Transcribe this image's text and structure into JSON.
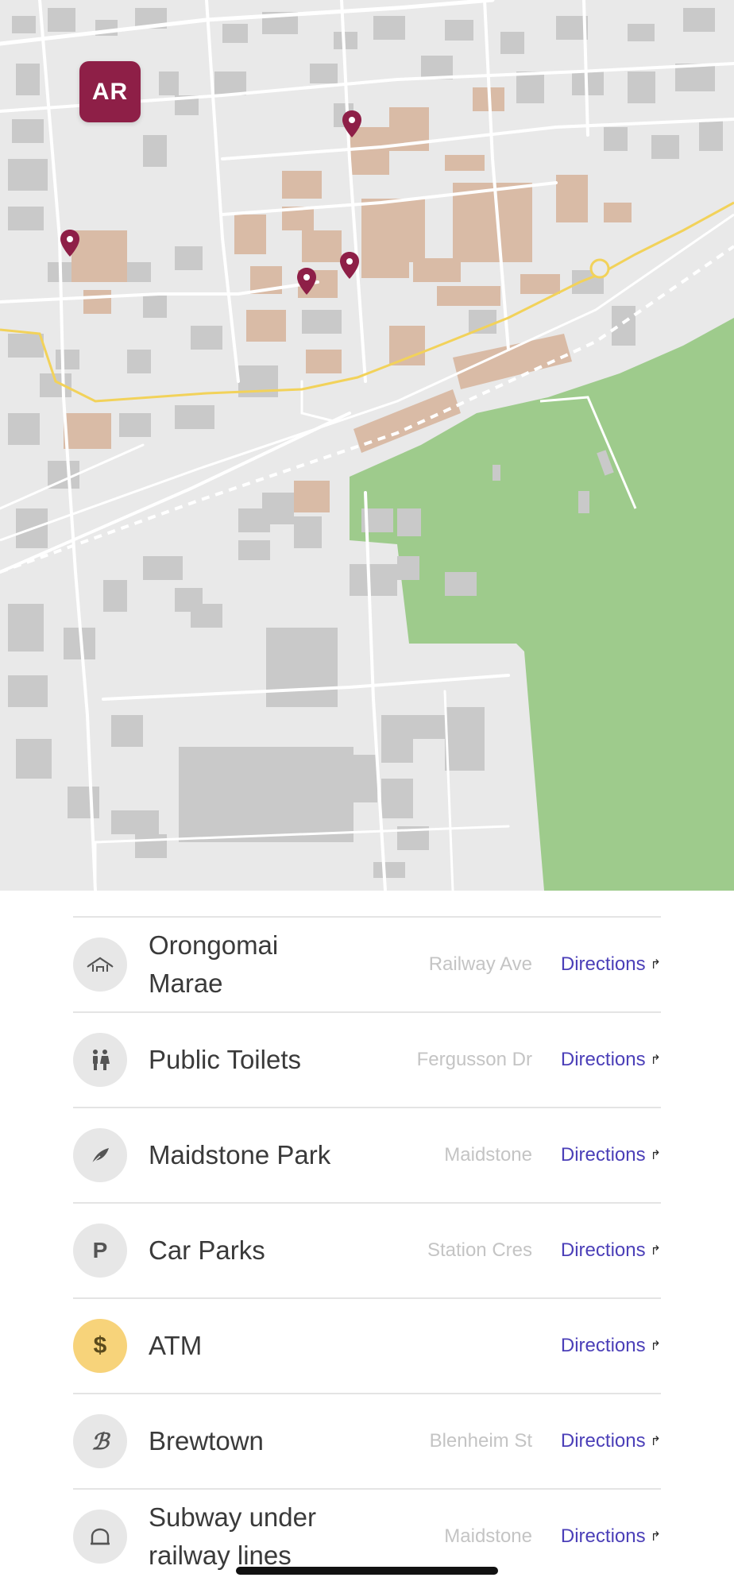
{
  "map": {
    "ar_button_label": "AR",
    "colors": {
      "background": "#e9e9e9",
      "roads": "#ffffff",
      "buildings": "#c9c9c9",
      "highlight_buildings": "#d9bba6",
      "park": "#9ecb8c",
      "main_road": "#f2d25a",
      "pin": "#8e1f47"
    },
    "pin_icon": "map-pin-icon"
  },
  "places": [
    {
      "name": "Orongomai Marae",
      "location": "Railway Ave",
      "action": "Directions",
      "icon": "marae-icon",
      "icon_glyph": "⌂"
    },
    {
      "name": "Public Toilets",
      "location": "Fergusson Dr",
      "action": "Directions",
      "icon": "toilets-icon",
      "icon_glyph": "👫"
    },
    {
      "name": "Maidstone Park",
      "location": "Maidstone",
      "action": "Directions",
      "icon": "leaf-icon",
      "icon_glyph": "❦"
    },
    {
      "name": "Car Parks",
      "location": "Station Cres",
      "action": "Directions",
      "icon": "parking-icon",
      "icon_glyph": "P"
    },
    {
      "name": "ATM",
      "location": "",
      "action": "Directions",
      "icon": "dollar-icon",
      "icon_glyph": "$"
    },
    {
      "name": "Brewtown",
      "location": "Blenheim St",
      "action": "Directions",
      "icon": "brewtown-icon",
      "icon_glyph": "ℬ"
    },
    {
      "name": "Subway under railway lines",
      "location": "Maidstone",
      "action": "Directions",
      "icon": "subway-icon",
      "icon_glyph": "⌒"
    }
  ],
  "directions_arrow_icon": "turn-arrow-icon",
  "directions_arrow_glyph": "↱"
}
